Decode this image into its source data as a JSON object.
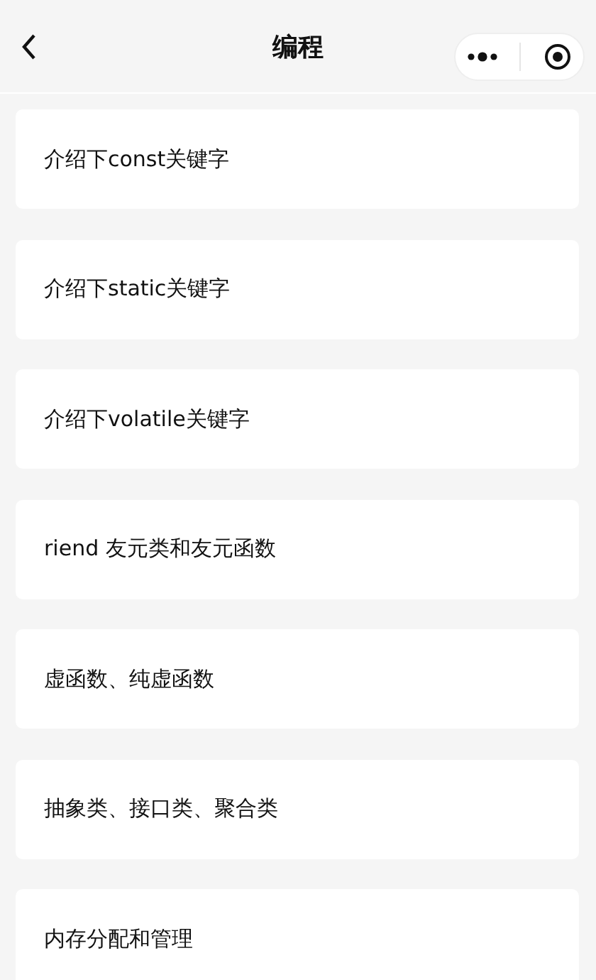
{
  "nav_bar": {
    "title": "编程"
  },
  "items": [
    {
      "label": "介绍下const关键字"
    },
    {
      "label": "介绍下static关键字"
    },
    {
      "label": "介绍下volatile关键字"
    },
    {
      "label": "riend 友元类和友元函数"
    },
    {
      "label": "虚函数、纯虚函数"
    },
    {
      "label": "抽象类、接口类、聚合类"
    },
    {
      "label": "内存分配和管理"
    }
  ]
}
